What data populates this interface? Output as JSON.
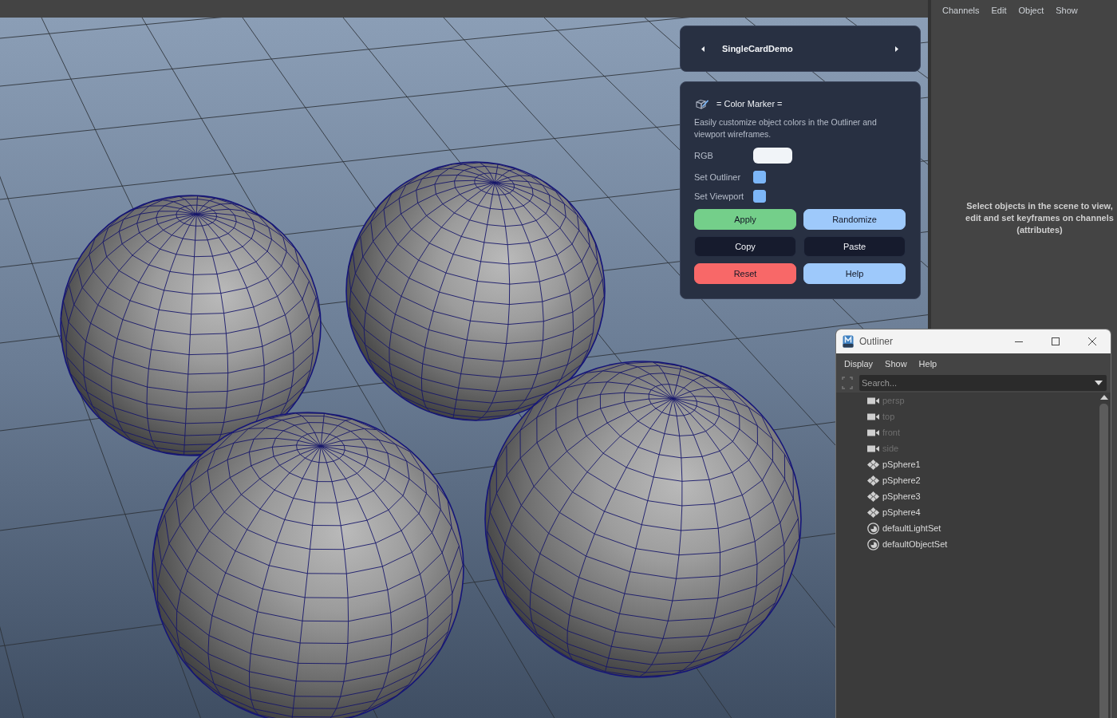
{
  "demo_header": {
    "title": "SingleCardDemo"
  },
  "tool_card": {
    "title": "= Color Marker =",
    "description": "Easily customize object colors in the Outliner and viewport wireframes.",
    "rgb": {
      "label": "RGB",
      "color": "#f1f4f8"
    },
    "toggles": [
      {
        "label": "Set Outliner",
        "checked": true
      },
      {
        "label": "Set Viewport",
        "checked": true
      }
    ],
    "buttons": [
      {
        "label": "Apply",
        "color": "#74cf8a"
      },
      {
        "label": "Randomize",
        "color": "#9ec9fb"
      },
      {
        "label": "Copy",
        "color": "#161b2d"
      },
      {
        "label": "Paste",
        "color": "#161b2d"
      },
      {
        "label": "Reset",
        "color": "#f86868"
      },
      {
        "label": "Help",
        "color": "#9ec9fb"
      }
    ]
  },
  "channel_box": {
    "menu": [
      "Channels",
      "Edit",
      "Object",
      "Show"
    ],
    "message": "Select objects in the scene to view, edit and set keyframes on channels (attributes)"
  },
  "outliner": {
    "title": "Outliner",
    "menu": [
      "Display",
      "Show",
      "Help"
    ],
    "search": {
      "placeholder": "Search..."
    },
    "items": [
      {
        "label": "persp",
        "kind": "camera",
        "dimmed": true,
        "selected": false
      },
      {
        "label": "top",
        "kind": "camera",
        "dimmed": true,
        "selected": false
      },
      {
        "label": "front",
        "kind": "camera",
        "dimmed": true,
        "selected": false
      },
      {
        "label": "side",
        "kind": "camera",
        "dimmed": true,
        "selected": false
      },
      {
        "label": "pSphere1",
        "kind": "mesh",
        "dimmed": false,
        "selected": false
      },
      {
        "label": "pSphere2",
        "kind": "mesh",
        "dimmed": false,
        "selected": false
      },
      {
        "label": "pSphere3",
        "kind": "mesh",
        "dimmed": false,
        "selected": false
      },
      {
        "label": "pSphere4",
        "kind": "mesh",
        "dimmed": false,
        "selected": false
      },
      {
        "label": "defaultLightSet",
        "kind": "set",
        "dimmed": false,
        "selected": false
      },
      {
        "label": "defaultObjectSet",
        "kind": "set",
        "dimmed": false,
        "selected": false
      }
    ]
  }
}
